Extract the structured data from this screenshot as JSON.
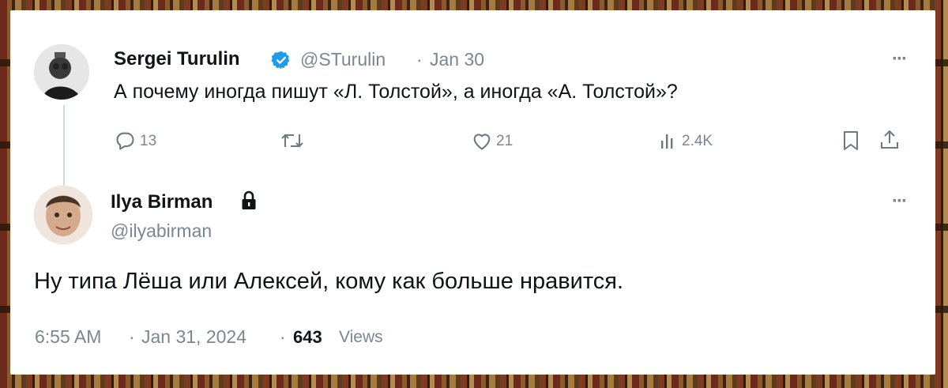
{
  "tweet1": {
    "author_name": "Sergei Turulin",
    "handle": "@STurulin",
    "separator": "·",
    "date": "Jan 30",
    "text": "А почему иногда пишут «Л. Толстой», а иногда «А. Толстой»?",
    "replies": "13",
    "likes": "21",
    "views": "2.4K",
    "more": "···",
    "icons": [
      "verified-badge-icon",
      "reply-icon",
      "retweet-icon",
      "like-icon",
      "analytics-icon",
      "bookmark-icon",
      "share-icon"
    ]
  },
  "tweet2": {
    "author_name": "Ilya Birman",
    "handle": "@ilyabirman",
    "text": "Ну типа Лёша или Алексей, кому как больше нравится.",
    "time": "6:55 AM",
    "sep1": "·",
    "date": "Jan 31, 2024",
    "sep2": "·",
    "views_count": "643",
    "views_label": "Views",
    "more": "···",
    "icons": [
      "lock-icon"
    ]
  },
  "colors": {
    "verified": "#1d9bf0",
    "text": "#0f1419",
    "muted": "#7a8793",
    "thread_line": "#cfd9de"
  }
}
